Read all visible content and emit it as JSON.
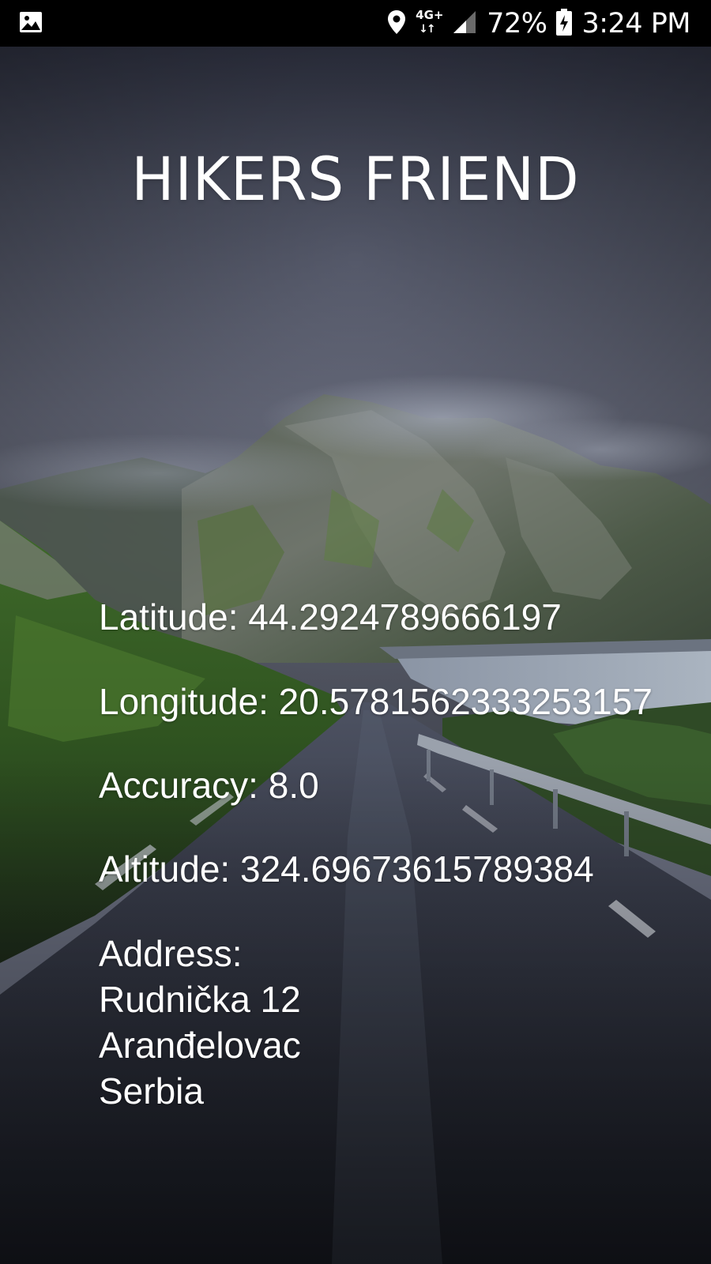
{
  "status_bar": {
    "left_icon": "image-icon",
    "location_icon": "location-pin-icon",
    "network_type": "4G+",
    "signal_icon": "signal-icon",
    "battery_percent": "72%",
    "battery_icon": "battery-charging-icon",
    "time": "3:24 PM"
  },
  "app": {
    "title": "HIKERS FRIEND"
  },
  "location": {
    "latitude_label": "Latitude:",
    "latitude_value": "44.2924789666197",
    "longitude_label": "Longitude:",
    "longitude_value": "20.5781562333253157",
    "accuracy_label": "Accuracy:",
    "accuracy_value": "8.0",
    "altitude_label": "Altitude:",
    "altitude_value": "324.69673615789384",
    "address_label": "Address:",
    "address_line1": "Rudnička 12",
    "address_line2": "Aranđelovac",
    "address_line3": "Serbia"
  },
  "colors": {
    "status_bar_bg": "#000000",
    "text": "#ffffff",
    "sky": "#5d6275",
    "road": "#2a2e3a"
  }
}
